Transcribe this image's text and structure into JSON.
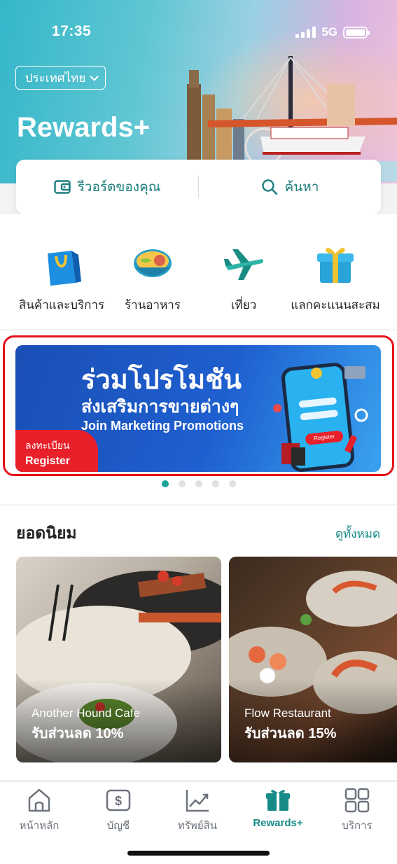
{
  "status": {
    "time": "17:35",
    "network": "5G"
  },
  "header": {
    "country_selector": "ประเทศไทย",
    "title": "Rewards+"
  },
  "search_card": {
    "my_rewards_label": "รีวอร์ดของคุณ",
    "search_label": "ค้นหา"
  },
  "categories": [
    {
      "label": "สินค้าและบริการ",
      "icon": "shopping-bag-icon"
    },
    {
      "label": "ร้านอาหาร",
      "icon": "food-bowl-icon"
    },
    {
      "label": "เที่ยว",
      "icon": "airplane-icon"
    },
    {
      "label": "แลกคะแนนสะสม",
      "icon": "gift-box-icon"
    }
  ],
  "banner": {
    "title_th": "ร่วมโปรโมชัน",
    "subtitle_th": "ส่งเสริมการขายต่างๆ",
    "subtitle_en": "Join Marketing Promotions",
    "register_th": "ลงทะเบียน",
    "register_en": "Register",
    "phone_button": "Register",
    "page_count": 5,
    "active_page": 1
  },
  "popular": {
    "title": "ยอดนิยม",
    "see_all": "ดูทั้งหมด",
    "cards": [
      {
        "name": "Another Hound Cafe",
        "discount": "รับส่วนลด 10%"
      },
      {
        "name": "Flow Restaurant",
        "discount": "รับส่วนลด 15%"
      }
    ]
  },
  "bottom_nav": [
    {
      "label": "หน้าหลัก",
      "icon": "home-icon",
      "active": false
    },
    {
      "label": "บัญชี",
      "icon": "account-dollar-icon",
      "active": false
    },
    {
      "label": "ทรัพย์สิน",
      "icon": "chart-trend-icon",
      "active": false
    },
    {
      "label": "Rewards+",
      "icon": "gift-icon",
      "active": true
    },
    {
      "label": "บริการ",
      "icon": "services-grid-icon",
      "active": false
    }
  ],
  "colors": {
    "accent": "#168b87",
    "highlight": "#e4121b",
    "banner_blue": "#1e5fcf"
  }
}
